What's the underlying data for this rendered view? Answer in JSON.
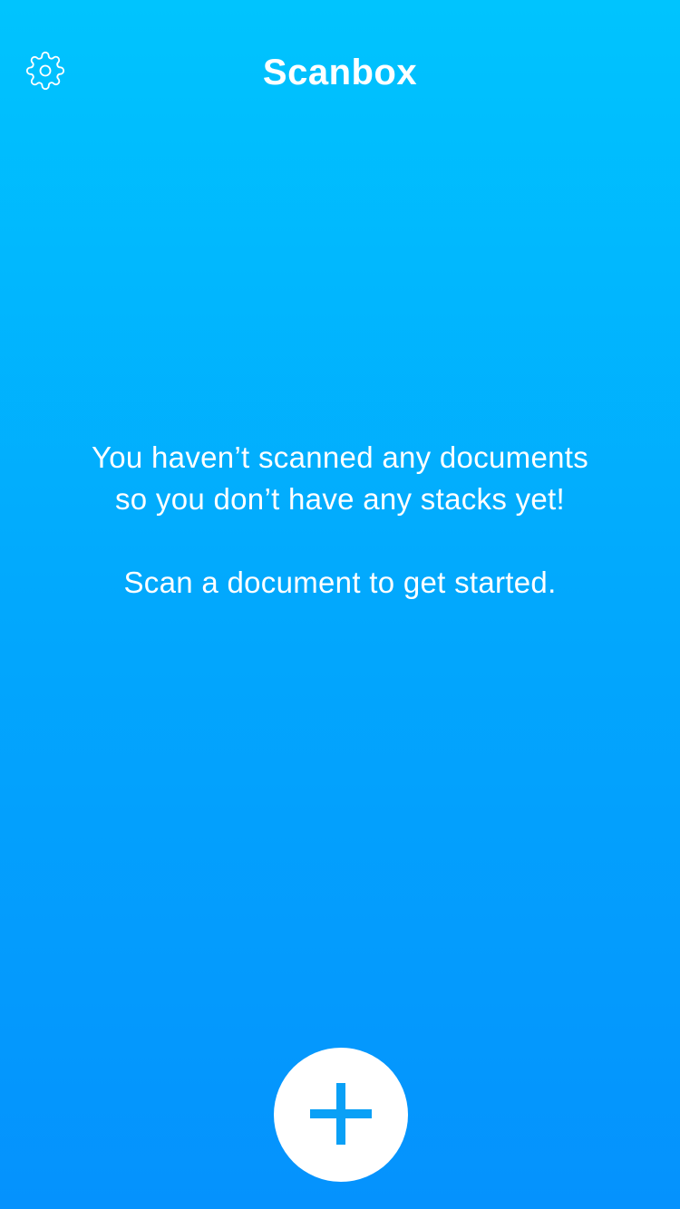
{
  "app": {
    "title": "Scanbox"
  },
  "nav": {
    "settings_icon": "gear-icon"
  },
  "empty_state": {
    "line1": "You haven’t scanned any documents",
    "line2": "so you don’t have any stacks yet!",
    "hint": "Scan a document to get started."
  },
  "actions": {
    "add_icon": "plus-icon"
  },
  "colors": {
    "gradient_top": "#00c4fe",
    "gradient_bottom": "#0592fd",
    "text": "#ffffff",
    "add_button_bg": "#ffffff",
    "add_icon": "#0aa0f6"
  }
}
